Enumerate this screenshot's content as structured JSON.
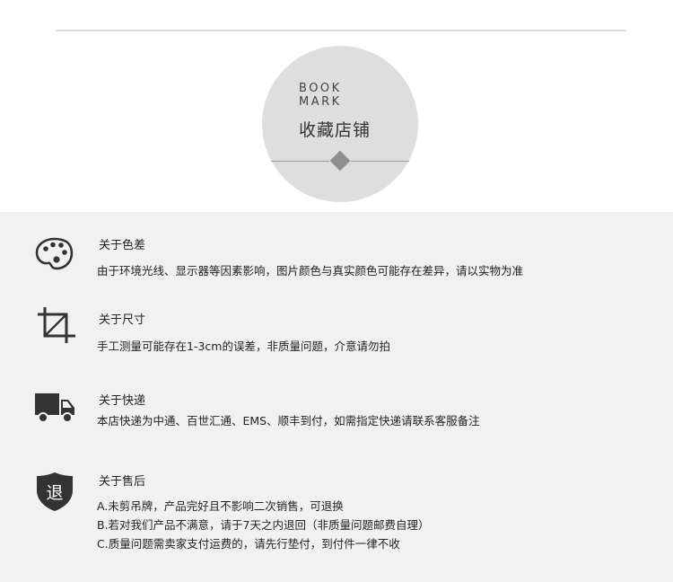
{
  "header": {
    "badge_en_line1": "BOOK",
    "badge_en_line2": "MARK",
    "badge_cn": "收藏店铺"
  },
  "sections": [
    {
      "icon": "palette-icon",
      "title": "关于色差",
      "lines": [
        "由于环境光线、显示器等因素影响，图片颜色与真实颜色可能存在差异，请以实物为准"
      ]
    },
    {
      "icon": "crop-icon",
      "title": "关于尺寸",
      "lines": [
        "手工测量可能存在1-3cm的误差，非质量问题，介意请勿拍"
      ]
    },
    {
      "icon": "truck-icon",
      "title": "关于快递",
      "lines": [
        "本店快递为中通、百世汇通、EMS、顺丰到付，如需指定快递请联系客服备注"
      ]
    },
    {
      "icon": "return-shield-icon",
      "icon_text": "退",
      "title": "关于售后",
      "lines": [
        "A.未剪吊牌，产品完好且不影响二次销售，可退换",
        "B.若对我们产品不满意，请于7天之内退回（非质量问题邮费自理）",
        "C.质量问题需卖家支付运费的，请先行垫付，到付件一律不收"
      ]
    }
  ]
}
